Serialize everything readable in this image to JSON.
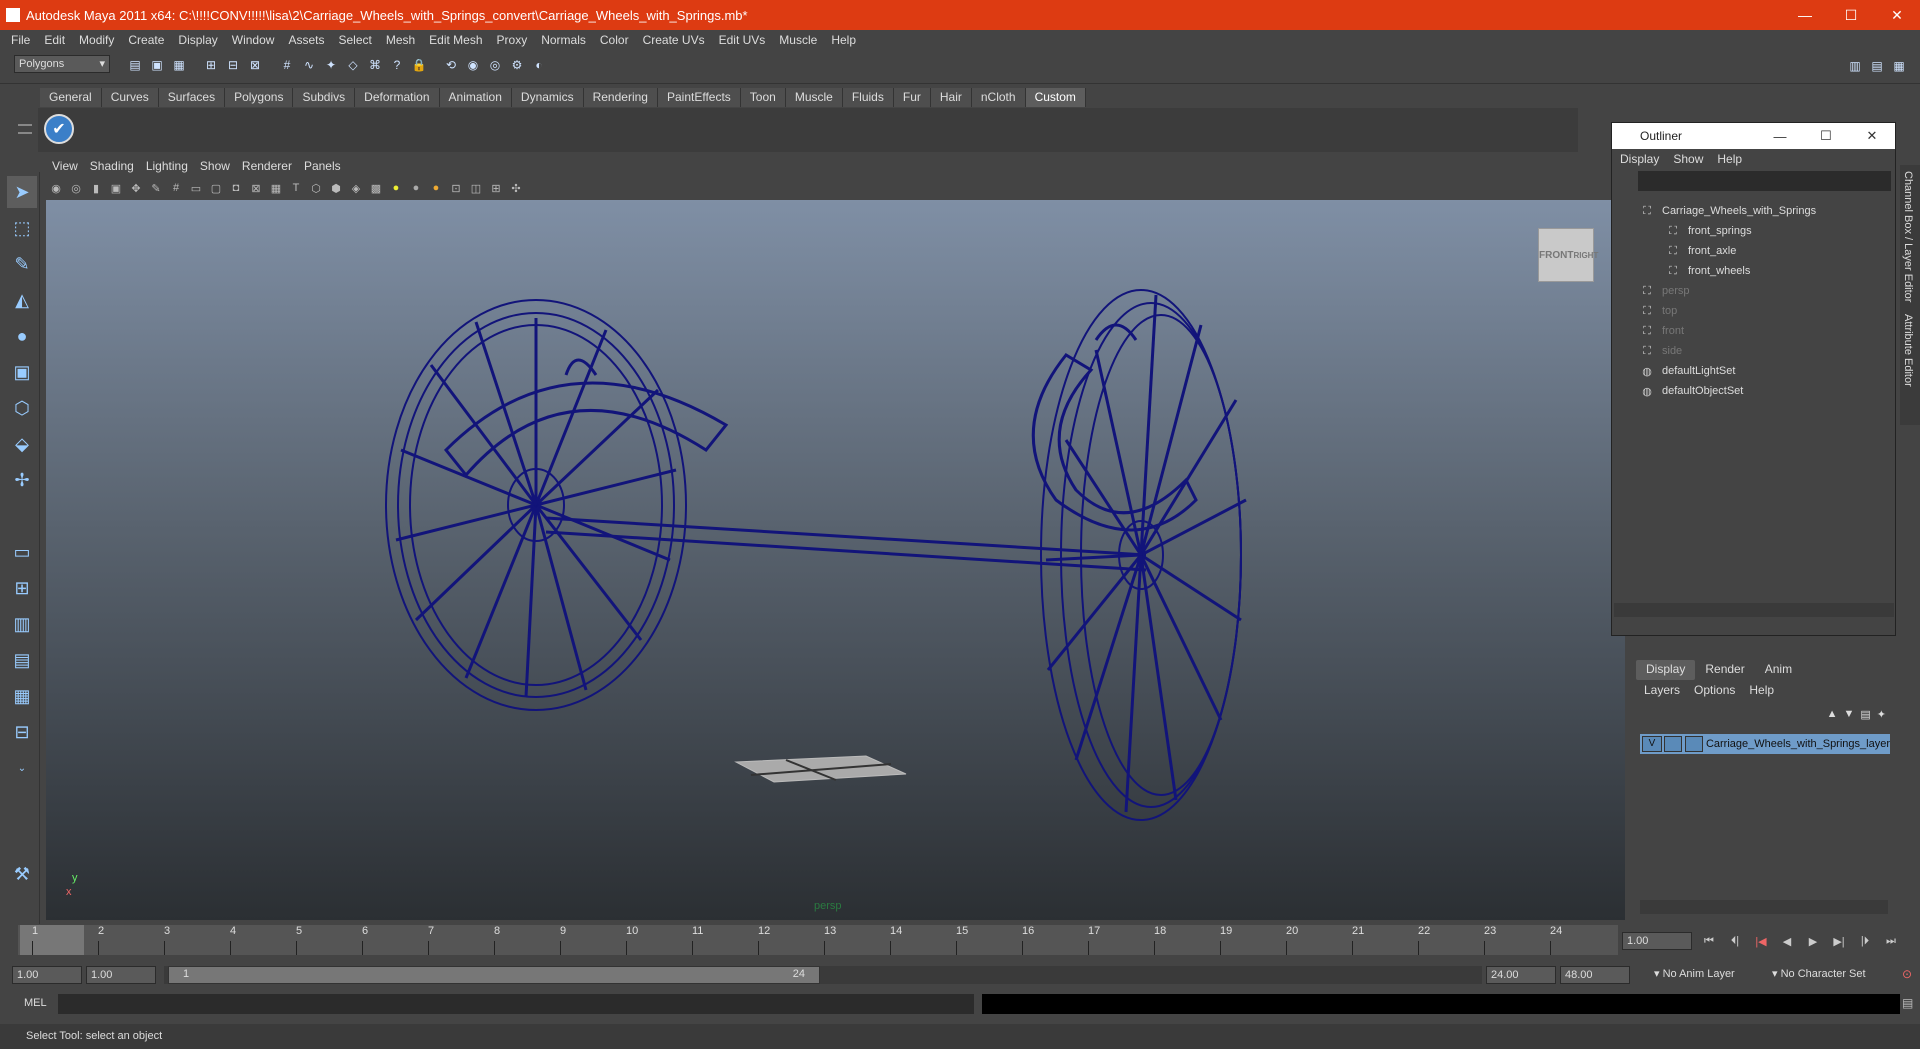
{
  "window": {
    "title": "Autodesk Maya 2011 x64: C:\\!!!!CONV!!!!!\\lisa\\2\\Carriage_Wheels_with_Springs_convert\\Carriage_Wheels_with_Springs.mb*",
    "minimize": "—",
    "maximize": "☐",
    "close": "✕"
  },
  "menubar": [
    "File",
    "Edit",
    "Modify",
    "Create",
    "Display",
    "Window",
    "Assets",
    "Select",
    "Mesh",
    "Edit Mesh",
    "Proxy",
    "Normals",
    "Color",
    "Create UVs",
    "Edit UVs",
    "Muscle",
    "Help"
  ],
  "statusline": {
    "mode_select": "Polygons"
  },
  "shelf": {
    "tabs": [
      "General",
      "Curves",
      "Surfaces",
      "Polygons",
      "Subdivs",
      "Deformation",
      "Animation",
      "Dynamics",
      "Rendering",
      "PaintEffects",
      "Toon",
      "Muscle",
      "Fluids",
      "Fur",
      "Hair",
      "nCloth",
      "Custom"
    ],
    "active_tab": "Custom"
  },
  "panel": {
    "menu": [
      "View",
      "Shading",
      "Lighting",
      "Show",
      "Renderer",
      "Panels"
    ],
    "camera_label": "persp",
    "viewcube_front": "FRONT",
    "viewcube_right": "RIGHT",
    "axis_y": "y",
    "axis_x": "x"
  },
  "outliner": {
    "title": "Outliner",
    "menu": [
      "Display",
      "Show",
      "Help"
    ],
    "items": [
      {
        "label": "Carriage_Wheels_with_Springs",
        "dim": false,
        "indent": 0
      },
      {
        "label": "front_springs",
        "dim": false,
        "indent": 1
      },
      {
        "label": "front_axle",
        "dim": false,
        "indent": 1
      },
      {
        "label": "front_wheels",
        "dim": false,
        "indent": 1
      },
      {
        "label": "persp",
        "dim": true,
        "indent": 0
      },
      {
        "label": "top",
        "dim": true,
        "indent": 0
      },
      {
        "label": "front",
        "dim": true,
        "indent": 0
      },
      {
        "label": "side",
        "dim": true,
        "indent": 0
      },
      {
        "label": "defaultLightSet",
        "dim": false,
        "indent": 0
      },
      {
        "label": "defaultObjectSet",
        "dim": false,
        "indent": 0
      }
    ]
  },
  "side_tabs": {
    "channel": "Channel Box / Layer Editor",
    "attribute": "Attribute Editor"
  },
  "layer_editor": {
    "tabs": [
      "Display",
      "Render",
      "Anim"
    ],
    "active_tab": "Display",
    "menu": [
      "Layers",
      "Options",
      "Help"
    ],
    "layer_visible": "V",
    "layer_name": "Carriage_Wheels_with_Springs_layer"
  },
  "time": {
    "ticks": [
      "1",
      "2",
      "3",
      "4",
      "5",
      "6",
      "7",
      "8",
      "9",
      "10",
      "11",
      "12",
      "13",
      "14",
      "15",
      "16",
      "17",
      "18",
      "19",
      "20",
      "21",
      "22",
      "23",
      "24"
    ],
    "current_frame": "1.00",
    "range_start": "1.00",
    "playback_start": "1.00",
    "range_slider_start": "1",
    "range_slider_end": "24",
    "playback_end": "24.00",
    "range_end": "48.00",
    "anim_layer": "No Anim Layer",
    "character_set": "No Character Set"
  },
  "command": {
    "label": "MEL",
    "help": "Select Tool: select an object"
  }
}
